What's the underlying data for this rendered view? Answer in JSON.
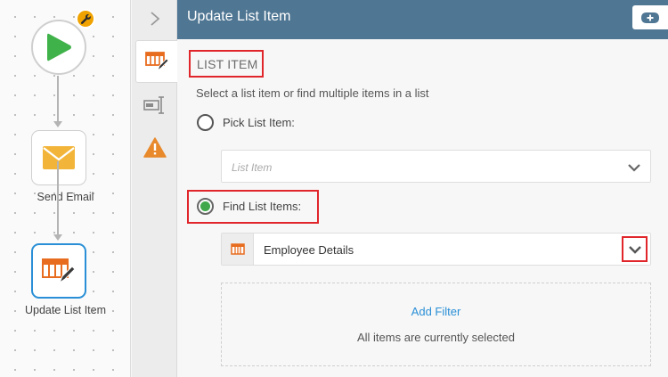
{
  "canvas": {
    "nodes": [
      {
        "label": ""
      },
      {
        "label": "Send Email"
      },
      {
        "label": "Update List Item"
      }
    ]
  },
  "header": {
    "title": "Update List Item"
  },
  "panel": {
    "section_title": "LIST ITEM",
    "description": "Select a list item or find multiple items in a list",
    "pick_option": {
      "label": "Pick List Item:",
      "checked": false
    },
    "pick_select": {
      "placeholder": "List Item"
    },
    "find_option": {
      "label": "Find List Items:",
      "checked": true
    },
    "list_select": {
      "value": "Employee Details"
    },
    "filter": {
      "add_label": "Add Filter",
      "note": "All items are currently selected"
    }
  },
  "colors": {
    "header_bg": "#4f7693",
    "play_green": "#40b24a",
    "email_yellow": "#f2b53a",
    "list_orange": "#e86c1f",
    "warning_orange": "#e8892b",
    "highlight_red": "#e0262b",
    "link_blue": "#2a8fd6",
    "radio_green": "#40a84a"
  },
  "icons": [
    "play-icon",
    "wrench-icon",
    "email-icon",
    "update-list-icon",
    "chevron-right-icon",
    "list-edit-icon",
    "text-field-icon",
    "warning-icon",
    "add-icon",
    "chevron-down-icon",
    "list-icon"
  ]
}
